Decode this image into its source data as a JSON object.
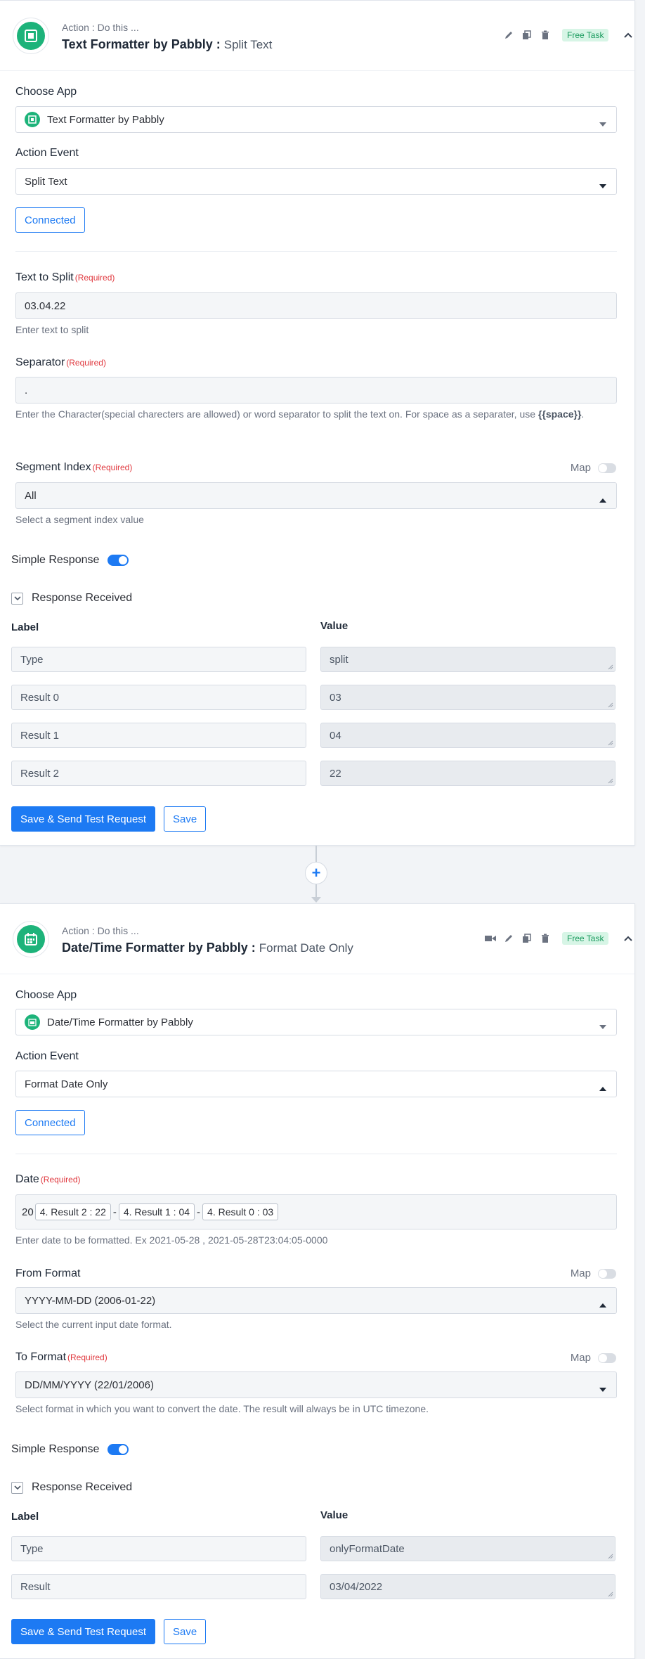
{
  "card1": {
    "subtitle": "Action : Do this ...",
    "app_name": "Text Formatter by Pabbly :",
    "event_name": "Split Text",
    "badge": "Free Task",
    "choose_app_label": "Choose App",
    "choose_app_value": "Text Formatter by Pabbly",
    "action_event_label": "Action Event",
    "action_event_value": "Split Text",
    "connected_label": "Connected",
    "text_to_split_label": "Text to Split",
    "text_to_split_value": "03.04.22",
    "text_to_split_help": "Enter text to split",
    "separator_label": "Separator",
    "separator_value": ".",
    "separator_help": "Enter the Character(special charecters are allowed) or word separator to split the text on. For space as a separater, use",
    "separator_help_code": "{{space}}",
    "segment_label": "Segment Index",
    "segment_value": "All",
    "segment_help": "Select a segment index value",
    "map_label": "Map",
    "simple_response_label": "Simple Response",
    "response_received_label": "Response Received",
    "col_label": "Label",
    "col_value": "Value",
    "rows": [
      {
        "label": "Type",
        "value": "split"
      },
      {
        "label": "Result 0",
        "value": "03"
      },
      {
        "label": "Result 1",
        "value": "04"
      },
      {
        "label": "Result 2",
        "value": "22"
      }
    ],
    "save_send_label": "Save & Send Test Request",
    "save_label": "Save"
  },
  "card2": {
    "subtitle": "Action : Do this ...",
    "app_name": "Date/Time Formatter by Pabbly :",
    "event_name": "Format Date Only",
    "badge": "Free Task",
    "choose_app_label": "Choose App",
    "choose_app_value": "Date/Time Formatter by Pabbly",
    "action_event_label": "Action Event",
    "action_event_value": "Format Date Only",
    "connected_label": "Connected",
    "date_label": "Date",
    "date_prefix": "20",
    "date_pill_1": "4. Result 2 : 22",
    "date_pill_2": "4. Result 1 : 04",
    "date_pill_3": "4. Result 0 : 03",
    "date_sep": "-",
    "date_help": "Enter date to be formatted. Ex 2021-05-28 , 2021-05-28T23:04:05-0000",
    "from_format_label": "From Format",
    "from_format_value": "YYYY-MM-DD (2006-01-22)",
    "from_format_help": "Select the current input date format.",
    "to_format_label": "To Format",
    "to_format_value": "DD/MM/YYYY (22/01/2006)",
    "to_format_help": "Select format in which you want to convert the date. The result will always be in UTC timezone.",
    "map_label": "Map",
    "simple_response_label": "Simple Response",
    "response_received_label": "Response Received",
    "col_label": "Label",
    "col_value": "Value",
    "rows": [
      {
        "label": "Type",
        "value": "onlyFormatDate"
      },
      {
        "label": "Result",
        "value": "03/04/2022"
      }
    ],
    "save_send_label": "Save & Send Test Request",
    "save_label": "Save"
  },
  "required_label": "(Required)",
  "add_step_symbol": "+",
  "colors": {
    "accent": "#1d7af3",
    "app_green": "#1db37a",
    "required": "#e0383e",
    "badge_bg": "#d7f5e6"
  }
}
